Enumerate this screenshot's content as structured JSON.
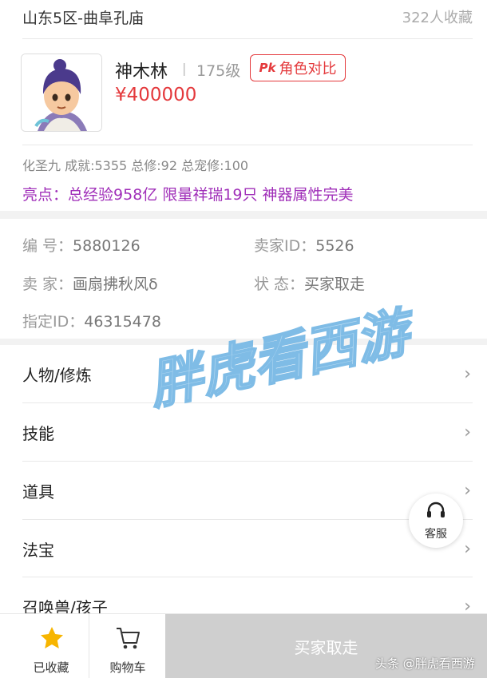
{
  "header": {
    "server": "山东5区-曲阜孔庙",
    "favorites": "322人收藏"
  },
  "role": {
    "name": "神木林",
    "separator": "|",
    "level": "175级",
    "compare_badge": "Pk",
    "compare_label": "角色对比",
    "price": "¥400000"
  },
  "stats": "化圣九 成就:5355 总修:92 总宠修:100",
  "highlights": {
    "label": "亮点：",
    "text": "总经验958亿 限量祥瑞19只 神器属性完美"
  },
  "info": {
    "id_label": "编  号：",
    "id_value": "5880126",
    "seller_id_label": "卖家ID：",
    "seller_id_value": "5526",
    "seller_label": "卖  家：",
    "seller_value": "画扇拂秋风δ",
    "status_label": "状  态：",
    "status_value": "买家取走",
    "assigned_label": "指定ID：",
    "assigned_value": "46315478"
  },
  "watermark": "胖虎看西游",
  "menu": [
    {
      "label": "人物/修炼"
    },
    {
      "label": "技能"
    },
    {
      "label": "道具"
    },
    {
      "label": "法宝"
    },
    {
      "label": "召唤兽/孩子"
    }
  ],
  "chevron": "›",
  "service": {
    "label": "客服",
    "icon": "headset-icon"
  },
  "bottom": {
    "favorited_label": "已收藏",
    "cart_label": "购物车",
    "action_label": "买家取走"
  },
  "credit": "头条 @胖虎看西游",
  "colors": {
    "accent": "#e4393c",
    "highlight": "#a02fb9",
    "star": "#f7b500",
    "disabled": "#cfcfcf"
  }
}
